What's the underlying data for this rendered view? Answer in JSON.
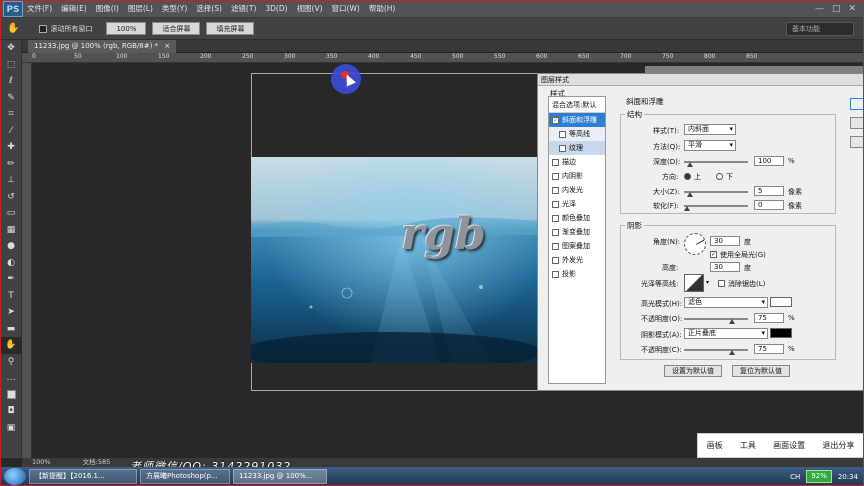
{
  "menubar": {
    "logo": "PS",
    "items": [
      "文件(F)",
      "编辑(E)",
      "图像(I)",
      "图层(L)",
      "类型(Y)",
      "选择(S)",
      "滤镜(T)",
      "3D(D)",
      "视图(V)",
      "窗口(W)",
      "帮助(H)"
    ],
    "controls": [
      "—",
      "□",
      "✕"
    ]
  },
  "options": {
    "scroll_all": "滚动所有窗口",
    "zoom": "100%",
    "fit_screen": "适合屏幕",
    "fill_screen": "填充屏幕",
    "workspace": "基本功能"
  },
  "document": {
    "tab": "11233.jpg @ 100% (rgb, RGB/8#) *",
    "close": "×",
    "image_text": "rgb"
  },
  "ruler": {
    "ticks": [
      "0",
      "50",
      "100",
      "150",
      "200",
      "250",
      "300",
      "350",
      "400",
      "450",
      "500",
      "550",
      "600",
      "650",
      "700",
      "750",
      "800",
      "850"
    ]
  },
  "dialog": {
    "title": "图层样式",
    "styles_header": "样式",
    "blend_options": "混合选项:默认",
    "style_items": [
      {
        "label": "斜面和浮雕",
        "checked": true,
        "active": true
      },
      {
        "label": "等高线",
        "checked": false,
        "sub": true
      },
      {
        "label": "纹理",
        "checked": false,
        "sub": true
      },
      {
        "label": "描边",
        "checked": false
      },
      {
        "label": "内阴影",
        "checked": false
      },
      {
        "label": "内发光",
        "checked": false
      },
      {
        "label": "光泽",
        "checked": false
      },
      {
        "label": "颜色叠加",
        "checked": false
      },
      {
        "label": "渐变叠加",
        "checked": false
      },
      {
        "label": "图案叠加",
        "checked": false
      },
      {
        "label": "外发光",
        "checked": false
      },
      {
        "label": "投影",
        "checked": false
      }
    ],
    "section_title": "斜面和浮雕",
    "structure": {
      "title": "结构",
      "style_label": "样式(T):",
      "style_value": "内斜面",
      "technique_label": "方法(Q):",
      "technique_value": "平滑",
      "depth_label": "深度(D):",
      "depth_value": "100",
      "percent": "%",
      "direction_label": "方向:",
      "dir_up": "上",
      "dir_down": "下",
      "size_label": "大小(Z):",
      "size_value": "5",
      "px": "像素",
      "soften_label": "软化(F):",
      "soften_value": "0"
    },
    "shading": {
      "title": "阴影",
      "angle_label": "角度(N):",
      "angle_value": "30",
      "degree": "度",
      "global_light": "使用全局光(G)",
      "altitude_label": "高度:",
      "altitude_value": "30",
      "gloss_label": "光泽等高线:",
      "antialias": "消除锯齿(L)",
      "highlight_mode_label": "高光模式(H):",
      "highlight_mode": "滤色",
      "highlight_opacity_label": "不透明度(O):",
      "highlight_opacity": "75",
      "shadow_mode_label": "阴影模式(A):",
      "shadow_mode": "正片叠底",
      "shadow_opacity_label": "不透明度(C):",
      "shadow_opacity": "75",
      "highlight_color": "#ffffff",
      "shadow_color": "#000000"
    },
    "btn_default": "设置为默认值",
    "btn_reset": "复位为默认值"
  },
  "status": {
    "zoom": "100%",
    "doc": "文档:585"
  },
  "watermark": "老师微信/QQ: 3142291032",
  "share": {
    "items": [
      "画板",
      "工具",
      "画面设置",
      "退出分享"
    ]
  },
  "taskbar": {
    "items": [
      "【新提醒】【2016.1...",
      "方展曦Photoshop(p...",
      "11233.jpg @ 100%..."
    ],
    "ime": "CH",
    "battery": "92%",
    "time": "20:34"
  }
}
